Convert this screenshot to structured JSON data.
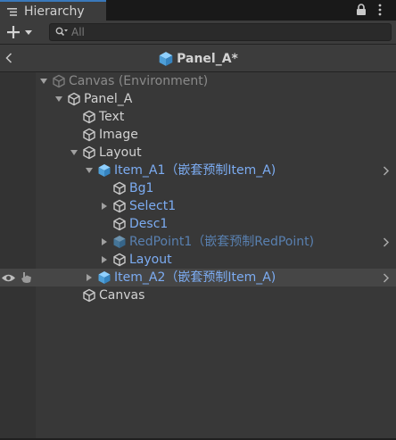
{
  "tab": {
    "title": "Hierarchy",
    "icon": "hierarchy-list-icon"
  },
  "toolbar": {
    "create_icon": "plus-dropdown-icon",
    "search": {
      "placeholder": "All",
      "value": "",
      "icon": "search-filter-icon"
    }
  },
  "prefab_header": {
    "title": "Panel_A*",
    "icon": "prefab-cube-icon",
    "back_icon": "chevron-left-icon"
  },
  "colors": {
    "text": "#d2d2d2",
    "text_dim": "#8a8a8a",
    "prefab_text": "#7cacf2",
    "prefab_text_dim": "#5980b0",
    "accent_tab": "#3a79bb",
    "prefab_cube": "#5fb0ea"
  },
  "tree": {
    "rows": [
      {
        "label": "Canvas (Environment)",
        "depth": 0,
        "expanded": true,
        "has_children": true,
        "kind": "gameobject",
        "style": "dim"
      },
      {
        "label": "Panel_A",
        "depth": 1,
        "expanded": true,
        "has_children": true,
        "kind": "gameobject",
        "style": "normal"
      },
      {
        "label": "Text",
        "depth": 2,
        "has_children": false,
        "kind": "gameobject",
        "style": "normal"
      },
      {
        "label": "Image",
        "depth": 2,
        "has_children": false,
        "kind": "gameobject",
        "style": "normal"
      },
      {
        "label": "Layout",
        "depth": 2,
        "expanded": true,
        "has_children": true,
        "kind": "gameobject",
        "style": "normal"
      },
      {
        "label": "Item_A1（嵌套预制Item_A)",
        "depth": 3,
        "expanded": true,
        "has_children": true,
        "kind": "prefab",
        "style": "prefab",
        "chevron": true
      },
      {
        "label": "Bg1",
        "depth": 4,
        "has_children": false,
        "kind": "gameobject",
        "style": "prefab"
      },
      {
        "label": "Select1",
        "depth": 4,
        "expanded": false,
        "has_children": true,
        "kind": "gameobject",
        "style": "prefab"
      },
      {
        "label": "Desc1",
        "depth": 4,
        "has_children": false,
        "kind": "gameobject",
        "style": "prefab"
      },
      {
        "label": "RedPoint1（嵌套预制RedPoint)",
        "depth": 4,
        "expanded": false,
        "has_children": true,
        "kind": "prefab",
        "style": "prefab-dim",
        "chevron": true
      },
      {
        "label": "Layout",
        "depth": 4,
        "expanded": false,
        "has_children": true,
        "kind": "gameobject",
        "style": "prefab"
      },
      {
        "label": "Item_A2（嵌套预制Item_A)",
        "depth": 3,
        "expanded": false,
        "has_children": true,
        "kind": "prefab",
        "style": "prefab",
        "chevron": true,
        "hover": true,
        "eye_icon": "visibility-eye-icon",
        "pick_icon": "pickability-hand-icon"
      },
      {
        "label": "Canvas",
        "depth": 2,
        "has_children": false,
        "kind": "gameobject",
        "style": "normal"
      }
    ]
  }
}
